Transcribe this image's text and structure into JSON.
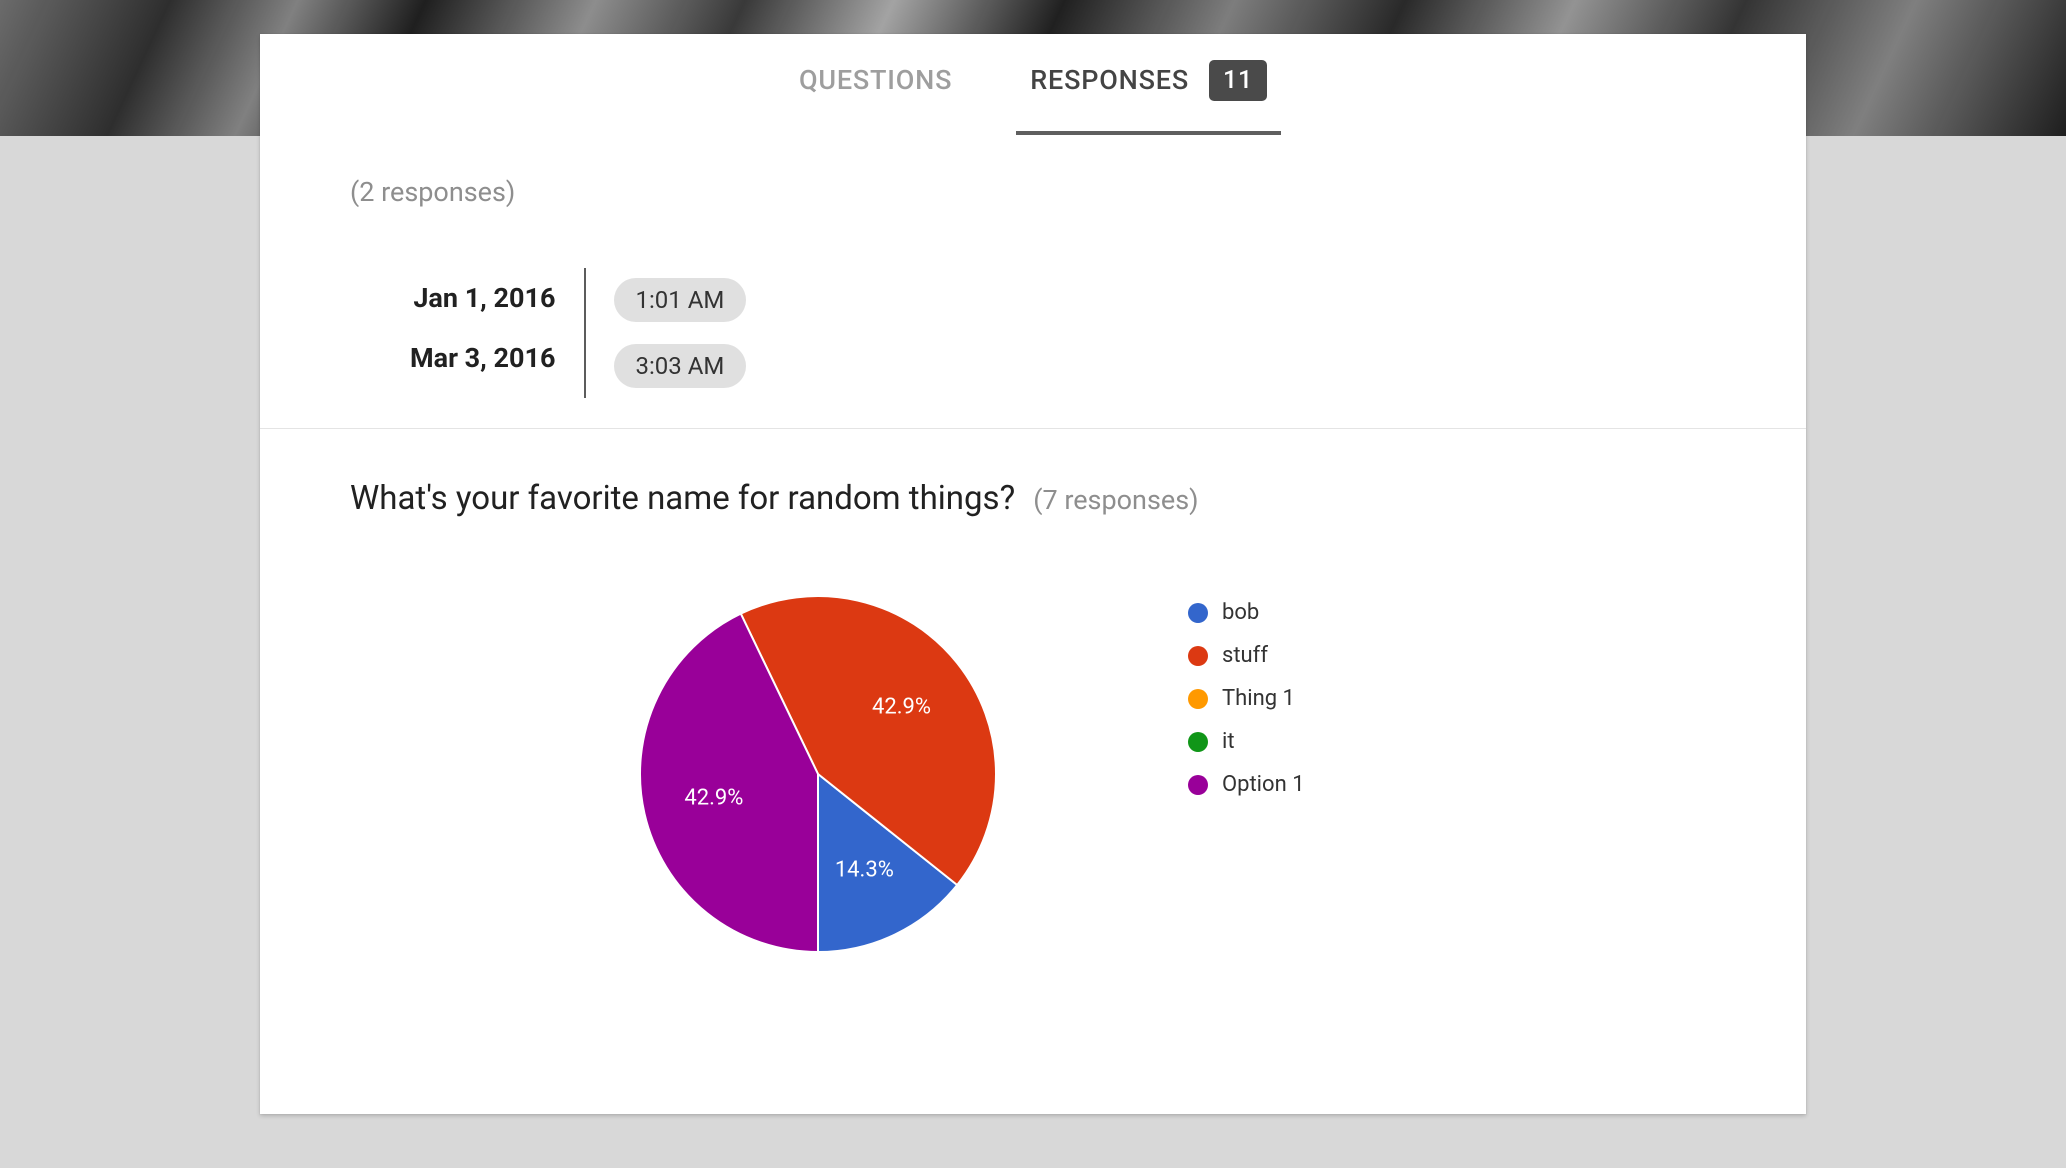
{
  "tabs": {
    "questions": "QUESTIONS",
    "responses": "RESPONSES",
    "responses_count": "11"
  },
  "time_question": {
    "count_label": "(2 responses)",
    "rows": [
      {
        "date": "Jan 1, 2016",
        "time": "1:01 AM"
      },
      {
        "date": "Mar 3, 2016",
        "time": "3:03 AM"
      }
    ]
  },
  "pie_question": {
    "title": "What's your favorite name for random things?",
    "count_label": "(7 responses)"
  },
  "colors": {
    "blue": "#3366cc",
    "red": "#dc3912",
    "orange": "#ff9900",
    "green": "#109618",
    "purple": "#990099"
  },
  "chart_data": {
    "type": "pie",
    "title": "What's your favorite name for random things?",
    "series": [
      {
        "name": "bob",
        "value": 1,
        "pct": 14.3,
        "color": "#3366cc"
      },
      {
        "name": "stuff",
        "value": 3,
        "pct": 42.9,
        "color": "#dc3912"
      },
      {
        "name": "Thing 1",
        "value": 0,
        "pct": 0.0,
        "color": "#ff9900"
      },
      {
        "name": "it",
        "value": 0,
        "pct": 0.0,
        "color": "#109618"
      },
      {
        "name": "Option 1",
        "value": 3,
        "pct": 42.9,
        "color": "#990099"
      }
    ],
    "total_responses": 7,
    "start_angle_deg": 90,
    "direction": "counterclockwise"
  }
}
